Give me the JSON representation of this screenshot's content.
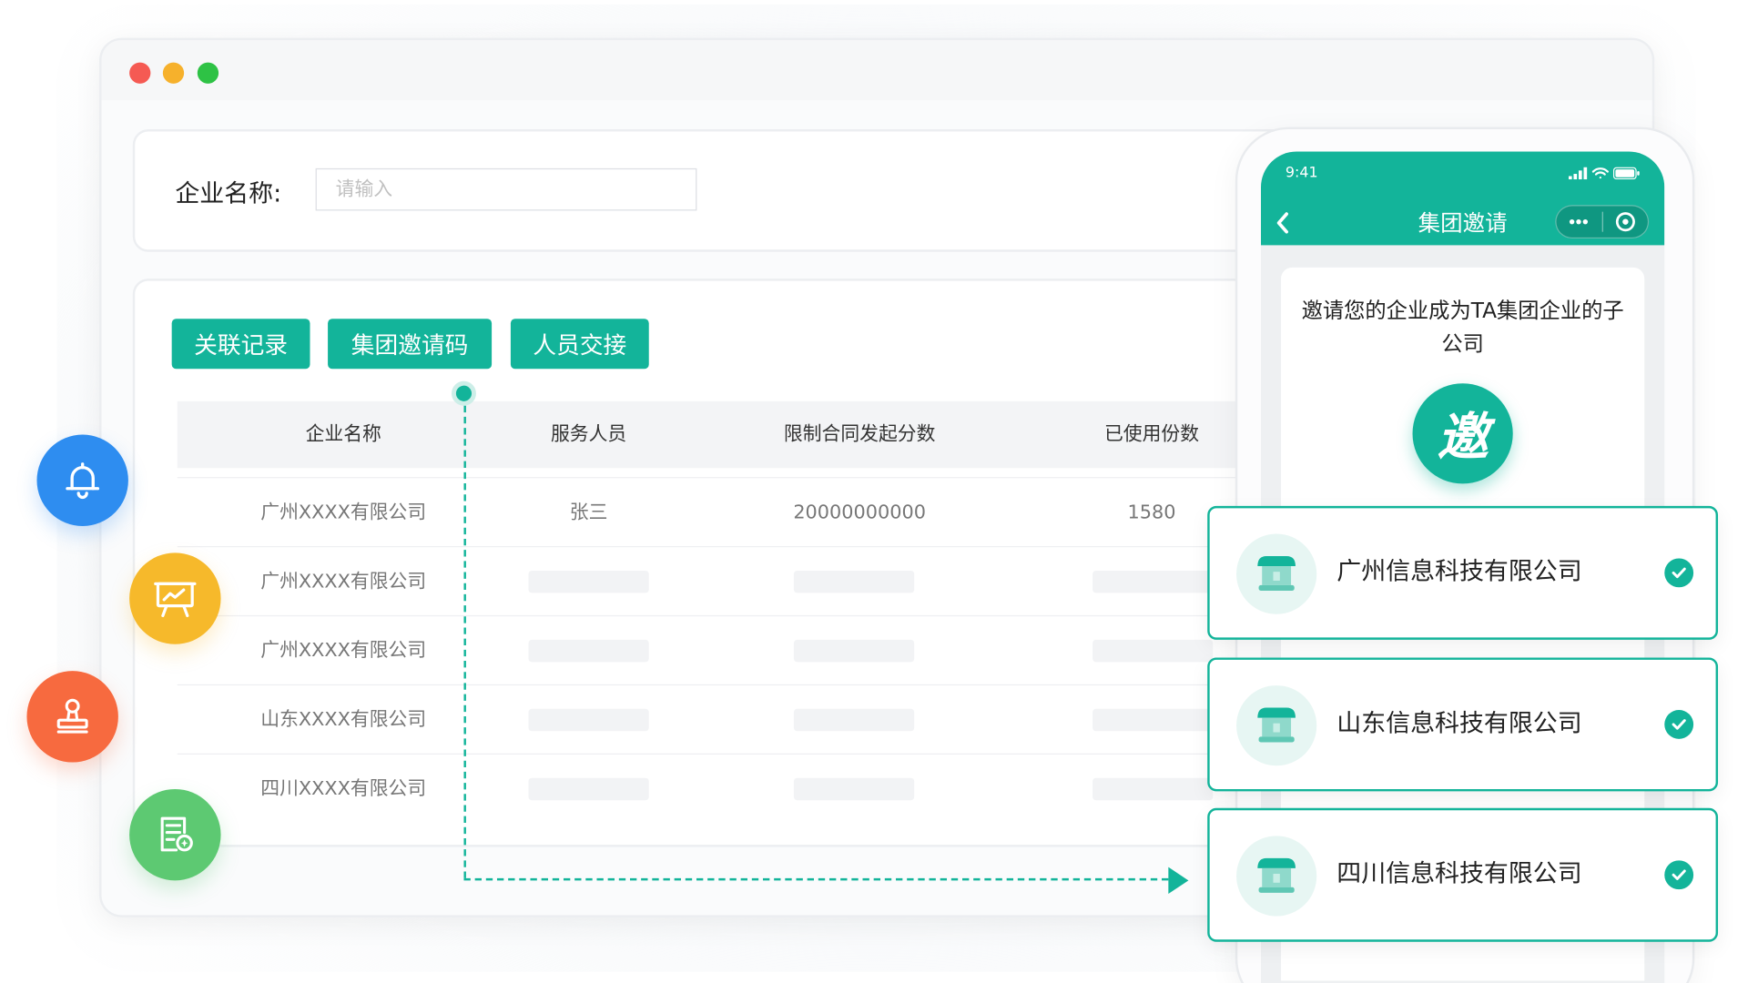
{
  "search": {
    "label": "企业名称:",
    "placeholder": "请输入",
    "value": ""
  },
  "toolbar": {
    "buttons": [
      "关联记录",
      "集团邀请码",
      "人员交接"
    ]
  },
  "table": {
    "columns": [
      "企业名称",
      "服务人员",
      "限制合同发起分数",
      "已使用份数"
    ],
    "rows": [
      {
        "company": "广州XXXX有限公司",
        "staff": "张三",
        "limit": "20000000000",
        "used": "1580"
      },
      {
        "company": "广州XXXX有限公司",
        "staff": "",
        "limit": "",
        "used": ""
      },
      {
        "company": "广州XXXX有限公司",
        "staff": "",
        "limit": "",
        "used": ""
      },
      {
        "company": "山东XXXX有限公司",
        "staff": "",
        "limit": "",
        "used": ""
      },
      {
        "company": "四川XXXX有限公司",
        "staff": "",
        "limit": "",
        "used": ""
      }
    ]
  },
  "side_icons": [
    "bell-icon",
    "presentation-board-icon",
    "stamp-icon",
    "certificate-icon"
  ],
  "phone": {
    "status_time": "9:41",
    "nav_title": "集团邀请",
    "invite_text": "邀请您的企业成为TA集团企业的子公司",
    "badge_char": "邀"
  },
  "companies": [
    {
      "name": "广州信息科技有限公司",
      "checked": true
    },
    {
      "name": "山东信息科技有限公司",
      "checked": true
    },
    {
      "name": "四川信息科技有限公司",
      "checked": true
    }
  ],
  "colors": {
    "brand": "#13b49a",
    "bell": "#2e8df0",
    "board": "#f6b92b",
    "stamp": "#f76a3f",
    "cert": "#5dc972"
  }
}
